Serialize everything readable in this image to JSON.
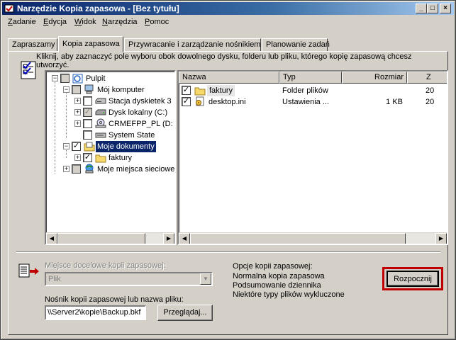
{
  "window": {
    "title": "Narzędzie Kopia zapasowa - [Bez tytułu]",
    "controls": {
      "minimize": "_",
      "maximize": "□",
      "close": "×"
    }
  },
  "menu": [
    {
      "label": "Zadanie",
      "mnemonic": "Z"
    },
    {
      "label": "Edycja",
      "mnemonic": "E"
    },
    {
      "label": "Widok",
      "mnemonic": "W"
    },
    {
      "label": "Narzędzia",
      "mnemonic": "N"
    },
    {
      "label": "Pomoc",
      "mnemonic": "P"
    }
  ],
  "tabs": [
    {
      "label": "Zapraszamy",
      "active": false
    },
    {
      "label": "Kopia zapasowa",
      "active": true
    },
    {
      "label": "Przywracanie i zarządzanie nośnikiem",
      "active": false
    },
    {
      "label": "Planowanie zadań",
      "active": false
    }
  ],
  "instruction": "Kliknij, aby zaznaczyć pole wyboru obok dowolnego dysku, folderu lub pliku, którego kopię zapasową chcesz utworzyć.",
  "tree": {
    "items": [
      {
        "label": "Pulpit",
        "icon": "desktop-icon",
        "checkbox": "gray"
      },
      {
        "label": "Mój komputer",
        "icon": "computer-icon",
        "checkbox": "gray"
      },
      {
        "label": "Stacja dyskietek 3",
        "icon": "floppy-drive-icon",
        "checkbox": "empty"
      },
      {
        "label": "Dysk lokalny (C:)",
        "icon": "hard-drive-icon",
        "checkbox": "gray-check"
      },
      {
        "label": "CRMEFPP_PL (D:",
        "icon": "cd-drive-icon",
        "checkbox": "empty"
      },
      {
        "label": "System State",
        "icon": "system-state-icon",
        "checkbox": "empty"
      },
      {
        "label": "Moje dokumenty",
        "icon": "my-documents-icon",
        "checkbox": "checked",
        "selected": true
      },
      {
        "label": "faktury",
        "icon": "folder-icon",
        "checkbox": "checked"
      },
      {
        "label": "Moje miejsca sieciowe",
        "icon": "network-places-icon",
        "checkbox": "gray"
      }
    ]
  },
  "list": {
    "columns": [
      "Nazwa",
      "Typ",
      "Rozmiar",
      "Z"
    ],
    "rows": [
      {
        "name": "faktury",
        "type": "Folder plików",
        "size": "",
        "modified": "20",
        "icon": "folder-icon",
        "checked": true
      },
      {
        "name": "desktop.ini",
        "type": "Ustawienia ...",
        "size": "1 KB",
        "modified": "20",
        "icon": "ini-file-icon",
        "checked": true
      }
    ]
  },
  "destination": {
    "label": "Miejsce docelowe kopii zapasowej:",
    "value": "Plik",
    "media_label": "Nośnik kopii zapasowej lub nazwa pliku:",
    "media_value": "\\\\Server2\\kopie\\Backup.bkf",
    "browse_label": "Przeglądaj..."
  },
  "options": {
    "title": "Opcje kopii zapasowej:",
    "lines": [
      "Normalna kopia zapasowa",
      "Podsumowanie dziennika",
      "Niektóre typy plików wykluczone"
    ]
  },
  "start_button": "Rozpocznij",
  "colors": {
    "accent": "#0a246a",
    "highlight": "#c00000",
    "face": "#d4d0c8"
  }
}
